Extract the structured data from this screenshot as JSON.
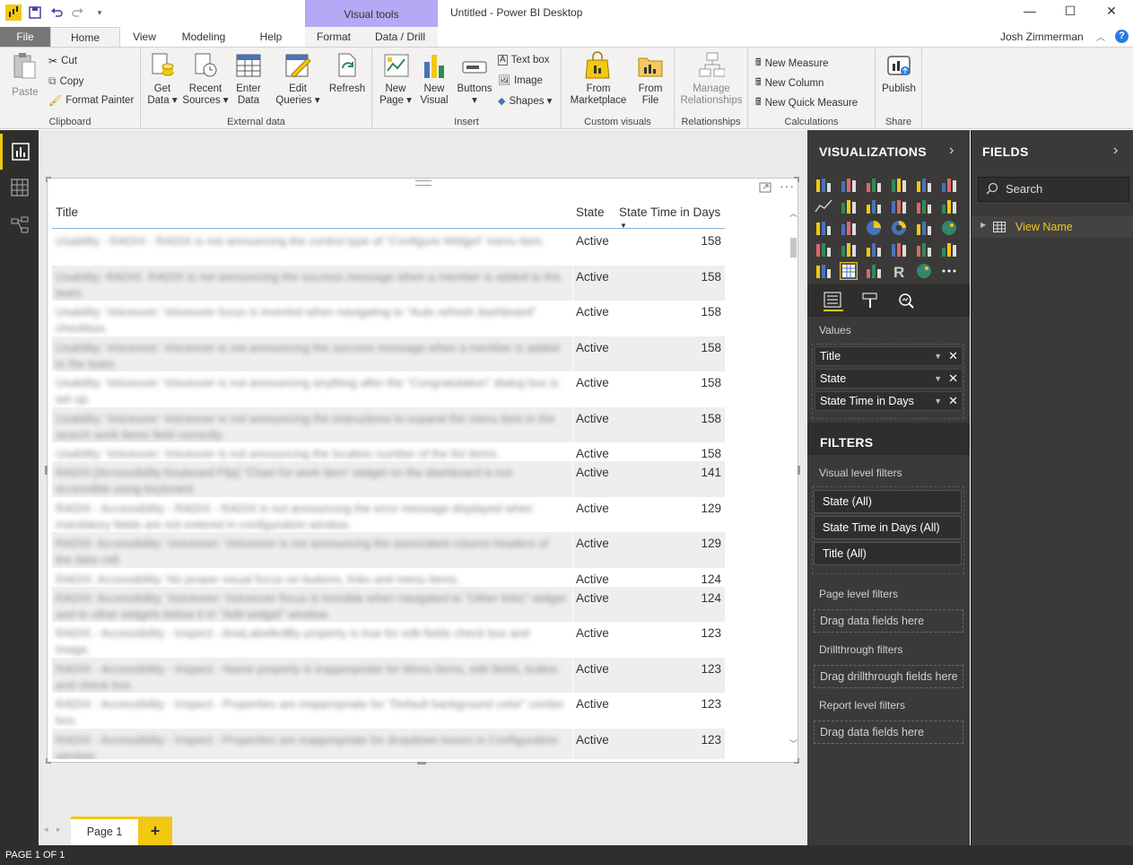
{
  "window": {
    "title": "Untitled - Power BI Desktop",
    "context_tab": "Visual tools",
    "minimize": "—",
    "maximize": "☐",
    "close": "✕"
  },
  "tabs": [
    "File",
    "Home",
    "View",
    "Modeling",
    "Help",
    "Format",
    "Data / Drill"
  ],
  "user": {
    "name": "Josh Zimmerman",
    "help": "?"
  },
  "ribbon": {
    "clipboard": {
      "label": "Clipboard",
      "paste": "Paste",
      "cut": "Cut",
      "copy": "Copy",
      "format_painter": "Format Painter"
    },
    "external_data": {
      "label": "External data",
      "get_data": [
        "Get",
        "Data ▾"
      ],
      "recent_sources": [
        "Recent",
        "Sources ▾"
      ],
      "enter_data": [
        "Enter",
        "Data"
      ],
      "edit_queries": [
        "Edit",
        "Queries ▾"
      ],
      "refresh": "Refresh"
    },
    "insert": {
      "label": "Insert",
      "new_page": [
        "New",
        "Page ▾"
      ],
      "new_visual": [
        "New",
        "Visual"
      ],
      "buttons": [
        "Buttons",
        "▾"
      ],
      "text_box": "Text box",
      "image": "Image",
      "shapes": "Shapes ▾"
    },
    "custom_visuals": {
      "label": "Custom visuals",
      "from_marketplace": [
        "From",
        "Marketplace"
      ],
      "from_file": [
        "From",
        "File"
      ]
    },
    "relationships": {
      "label": "Relationships",
      "manage": [
        "Manage",
        "Relationships"
      ]
    },
    "calculations": {
      "label": "Calculations",
      "new_measure": "New Measure",
      "new_column": "New Column",
      "new_quick_measure": "New Quick Measure"
    },
    "share": {
      "label": "Share",
      "publish": "Publish"
    }
  },
  "table": {
    "headers": {
      "title": "Title",
      "state": "State",
      "days": "State Time in Days"
    },
    "rows": [
      {
        "title": "Usability - RADIX - RADIX is not announcing the control type of \"Configure Widget\" menu item.",
        "state": "Active",
        "days": "158",
        "lines": 2
      },
      {
        "title": "Usability: RADIX: RADIX is not announcing the success message when a member is added to the team.",
        "state": "Active",
        "days": "158",
        "lines": 2
      },
      {
        "title": "Usability: Voiceover: Voiceover focus is inverted when navigating to \"Auto refresh dashboard\" checkbox.",
        "state": "Active",
        "days": "158",
        "lines": 2
      },
      {
        "title": "Usability: Voiceover: Voiceover is not announcing the success message when a member is added to the team.",
        "state": "Active",
        "days": "158",
        "lines": 2
      },
      {
        "title": "Usability: Voiceover: Voiceover is not announcing anything after the \"Congratulation\" dialog box is set up.",
        "state": "Active",
        "days": "158",
        "lines": 2
      },
      {
        "title": "Usability: Voiceover: Voiceover is not announcing the instructions to expand the menu item in the search work items field correctly.",
        "state": "Active",
        "days": "158",
        "lines": 2
      },
      {
        "title": "Usability: Voiceover: Voiceover is not announcing the location number of the list items.",
        "state": "Active",
        "days": "158",
        "lines": 1
      },
      {
        "title": "RADIX:[Accessibility:Keyboard Flip] \"Chart for work item\" widget on the dashboard is not accessible using keyboard.",
        "state": "Active",
        "days": "141",
        "lines": 2
      },
      {
        "title": "RADIX - Accessibility - RADIX - RADIX is not announcing the error message displayed when mandatory fields are not entered in configuration window.",
        "state": "Active",
        "days": "129",
        "lines": 2
      },
      {
        "title": "RADIX: Accessibility: Voiceover: Voiceover is not announcing the associated column headers of the data cell.",
        "state": "Active",
        "days": "129",
        "lines": 2
      },
      {
        "title": "RADIX: Accessibility: No proper visual focus on buttons, links and menu items.",
        "state": "Active",
        "days": "124",
        "lines": 1
      },
      {
        "title": "RADIX: Accessibility: Voiceover: Voiceover focus is invisible when navigated to \"Other links\" widget and to other widgets below it in \"Add widget\" window.",
        "state": "Active",
        "days": "124",
        "lines": 2
      },
      {
        "title": "RADIX - Accessibility - Inspect - AriaLabelledBy property is true for edit fields check box and image.",
        "state": "Active",
        "days": "123",
        "lines": 2
      },
      {
        "title": "RADIX - Accessibility - Inspect - Name property is inappropriate for Menu items, edit fields, button and check box.",
        "state": "Active",
        "days": "123",
        "lines": 2
      },
      {
        "title": "RADIX - Accessibility - Inspect - Properties are inappropriate for \"Default background color\" combo box.",
        "state": "Active",
        "days": "123",
        "lines": 2
      },
      {
        "title": "RADIX - Accessibility - Inspect - Properties are inappropriate for dropdown boxes in Configuration window.",
        "state": "Active",
        "days": "123",
        "lines": 2
      }
    ]
  },
  "page_tabs": {
    "page": "Page 1",
    "add": "+"
  },
  "status": "PAGE 1 OF 1",
  "visualizations": {
    "title": "VISUALIZATIONS",
    "values_label": "Values",
    "wells": [
      "Title",
      "State",
      "State Time in Days"
    ]
  },
  "filters": {
    "title": "FILTERS",
    "visual_level": "Visual level filters",
    "visual_filters": [
      "State  (All)",
      "State Time in Days  (All)",
      "Title  (All)"
    ],
    "page_level": "Page level filters",
    "page_drop": "Drag data fields here",
    "drillthrough": "Drillthrough filters",
    "drillthrough_drop": "Drag drillthrough fields here",
    "report_level": "Report level filters",
    "report_drop": "Drag data fields here"
  },
  "fields": {
    "title": "FIELDS",
    "search_placeholder": "Search",
    "table_name": "View Name"
  },
  "colors": {
    "accent": "#f2c811",
    "pane_bg": "#3b3a39",
    "context_tab": "#b4a9f5"
  }
}
